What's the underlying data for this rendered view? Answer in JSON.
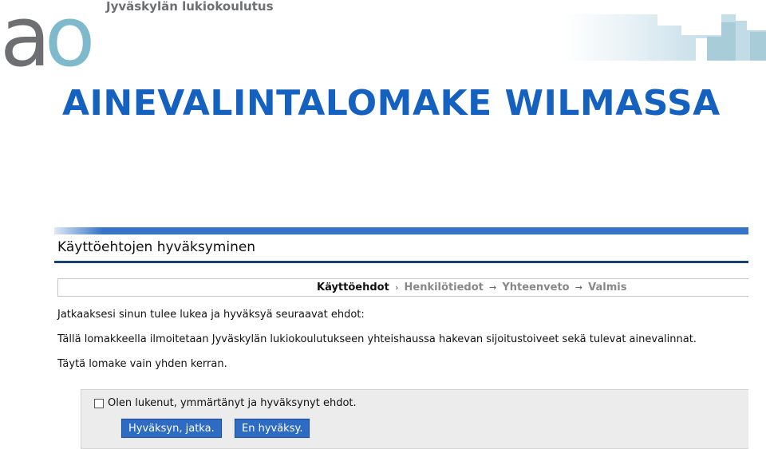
{
  "header": {
    "logo_letters": [
      "a",
      "o"
    ],
    "org_name": "Jyväskylän lukiokoulutus",
    "page_heading": "AINEVALINTALOMAKE WILMASSA"
  },
  "wilma": {
    "form_title": "Käyttöehtojen hyväksyminen",
    "steps": {
      "active": "Käyttöehdot",
      "first_separator": "›",
      "separator": "→",
      "items": [
        "Henkilötiedot",
        "Yhteenveto",
        "Valmis"
      ]
    },
    "paragraphs": [
      "Jatkaaksesi sinun tulee lukea ja hyväksyä seuraavat ehdot:",
      "Tällä lomakkeella ilmoitetaan Jyväskylän lukiokoulutukseen yhteishaussa hakevan sijoitustoiveet sekä tulevat ainevalinnat.",
      "Täytä lomake vain yhden kerran."
    ],
    "accept": {
      "checkbox_label": "Olen lukenut, ymmärtänyt ja hyväksynyt ehdot.",
      "checked": false,
      "accept_button": "Hyväksyn, jatka.",
      "decline_button": "En hyväksy."
    }
  },
  "colors": {
    "heading_blue": "#1561c0",
    "logo_gray": "#6d6f72",
    "logo_teal": "#7fb9cc",
    "wilma_bar": "#3774c9",
    "button_blue": "#2e6cc4"
  }
}
